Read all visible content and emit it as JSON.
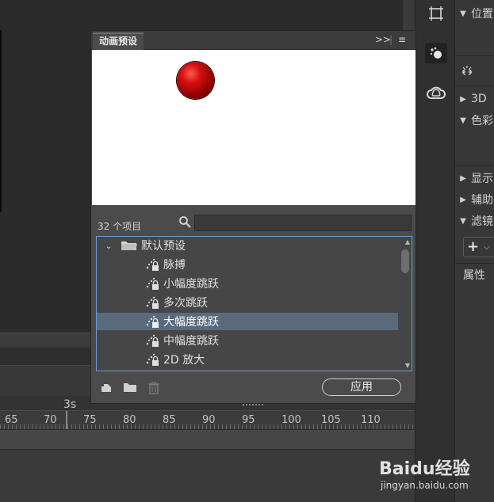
{
  "panel": {
    "tab_title": "动画预设",
    "item_count": "32 个项目",
    "search": {
      "value": "",
      "placeholder": ""
    },
    "folder": {
      "label": "默认预设"
    },
    "items": [
      {
        "label": "脉搏"
      },
      {
        "label": "小幅度跳跃"
      },
      {
        "label": "多次跳跃"
      },
      {
        "label": "大幅度跳跃",
        "selected": true
      },
      {
        "label": "中幅度跳跃"
      },
      {
        "label": "2D 放大"
      }
    ],
    "apply_label": "应用"
  },
  "timeline": {
    "playhead_label": "3s",
    "ruler_labels": [
      "65",
      "70",
      "75",
      "80",
      "85",
      "90",
      "95",
      "100",
      "105",
      "110"
    ]
  },
  "properties": {
    "sections": [
      {
        "label": "位置"
      },
      {
        "label": "3D"
      },
      {
        "label": "色彩"
      },
      {
        "label": "显示"
      },
      {
        "label": "辅助"
      },
      {
        "label": "滤镜"
      }
    ],
    "attr_label": "属性"
  },
  "watermark": {
    "logo": "Baidu经验",
    "url": "jingyan.baidu.com"
  },
  "colors": {
    "selection": "#5a6a7d",
    "tree_border": "#6f9bd6",
    "ball": "#c40000"
  }
}
